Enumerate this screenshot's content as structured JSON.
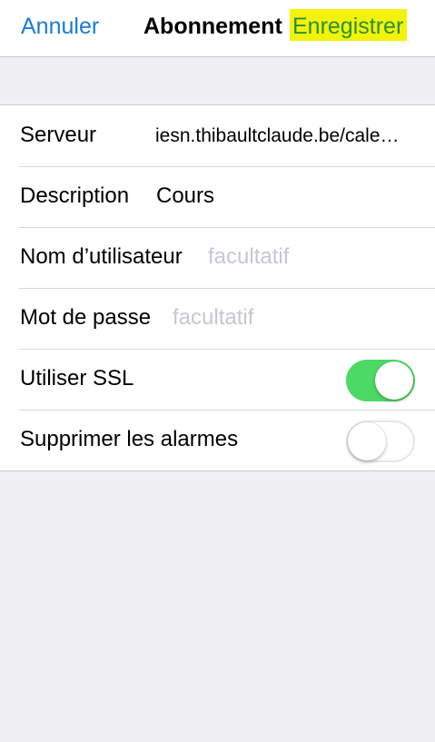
{
  "navbar": {
    "cancel_label": "Annuler",
    "title": "Abonnement",
    "save_label": "Enregistrer"
  },
  "form": {
    "server": {
      "label": "Serveur",
      "value": "iesn.thibaultclaude.be/cale…"
    },
    "description": {
      "label": "Description",
      "value": "Cours"
    },
    "username": {
      "label": "Nom d’utilisateur",
      "placeholder": "facultatif"
    },
    "password": {
      "label": "Mot de passe",
      "placeholder": "facultatif"
    },
    "ssl": {
      "label": "Utiliser SSL",
      "enabled": true
    },
    "alarms": {
      "label": "Supprimer les alarmes",
      "enabled": false
    }
  },
  "colors": {
    "accent": "#1a7bd8",
    "switch_on": "#4cd964",
    "highlight": "#f2f20a",
    "save_text": "#2c8f38",
    "background": "#efeff4"
  }
}
